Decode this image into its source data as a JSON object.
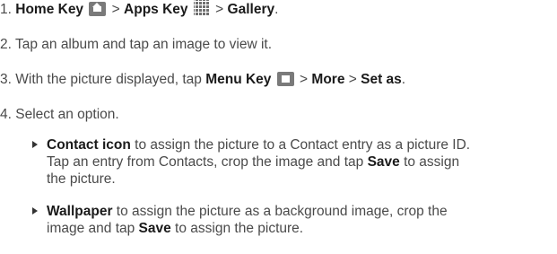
{
  "steps": [
    {
      "num": "1.",
      "parts": {
        "home": "Home Key",
        "sep1": " > ",
        "apps": "Apps Key",
        "sep2": " > ",
        "gallery": "Gallery",
        "end": "."
      }
    },
    {
      "num": "2.",
      "text": "Tap an album and tap an image to view it."
    },
    {
      "num": "3.",
      "parts": {
        "pre": "With the picture displayed, tap ",
        "menu": "Menu Key",
        "sep1": " > ",
        "more": "More",
        "sep2": " > ",
        "setas": "Set as",
        "end": "."
      }
    },
    {
      "num": "4.",
      "text": "Select an option."
    }
  ],
  "options": [
    {
      "label": "Contact icon",
      "line1": " to assign the picture to a Contact entry as a picture ID.",
      "line2_pre": "Tap an entry from Contacts, crop the image and tap ",
      "line2_bold": "Save",
      "line2_post": " to assign",
      "line3": "the picture."
    },
    {
      "label": "Wallpaper",
      "line1": " to assign the picture as a background image, crop the",
      "line2_pre": "image and tap ",
      "line2_bold": "Save",
      "line2_post": " to assign the picture."
    }
  ],
  "icons": {
    "home_key": "home-key-icon",
    "apps_key": "apps-key-icon",
    "menu_key": "menu-key-icon",
    "bullet": "triangle-bullet-icon"
  },
  "colors": {
    "text": "#4a4a4a",
    "bold": "#1a1a1a",
    "key_icon": "#7a7a7a"
  }
}
